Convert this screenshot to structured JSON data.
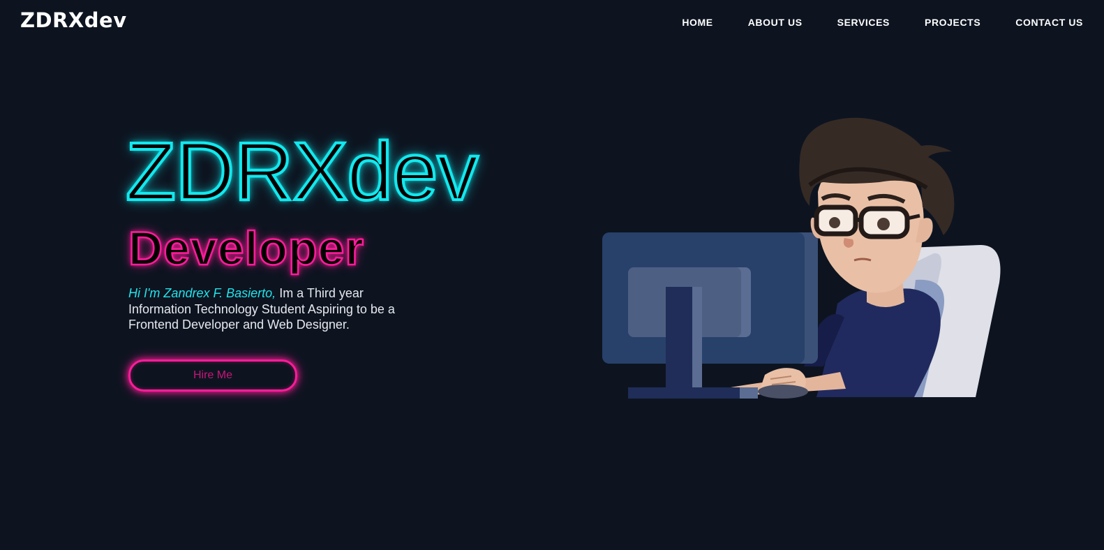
{
  "nav": {
    "brand": "ZDRXdev",
    "links": [
      "HOME",
      "ABOUT US",
      "SERVICES",
      "PROJECTS",
      "CONTACT US"
    ]
  },
  "hero": {
    "title": "ZDRXdev",
    "role": "Developer",
    "intro": "Hi I'm Zandrex F. Basierto,",
    "description": " Im a Third year Information Technology Student Aspiring to be a Frontend Developer and Web Designer.",
    "cta_label": "Hire Me"
  },
  "illustration": {
    "icon": "developer-at-computer-illustration"
  },
  "colors": {
    "background": "#0d1420",
    "cyan_accent": "#12e8ee",
    "pink_accent": "#ff1c9a",
    "text": "#ffffff"
  }
}
